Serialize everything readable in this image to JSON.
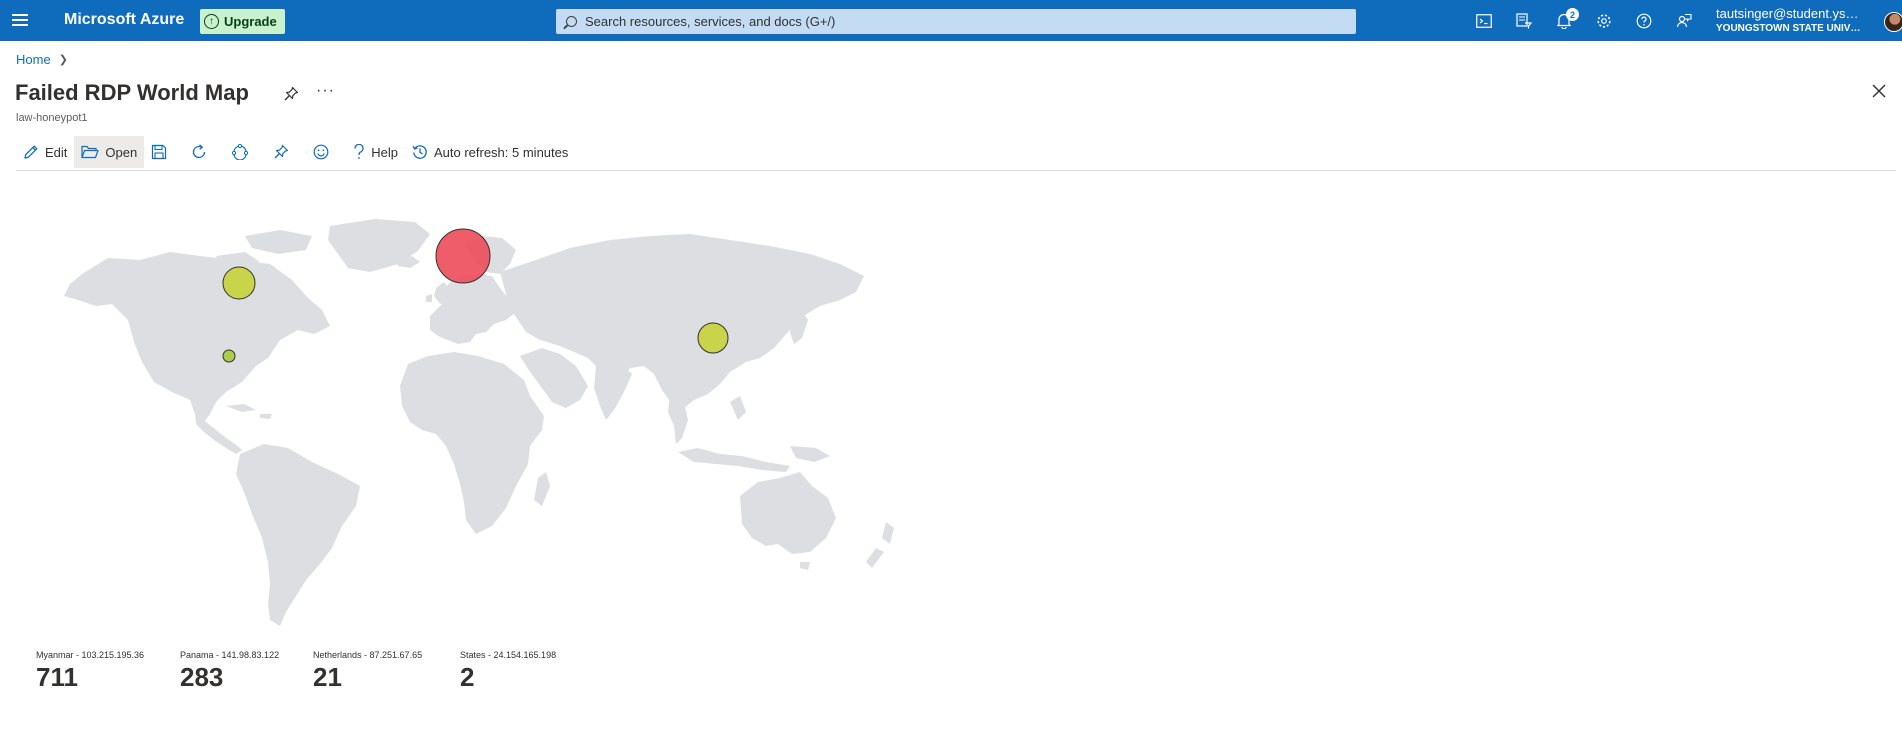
{
  "topbar": {
    "brand": "Microsoft Azure",
    "upgrade_label": "Upgrade",
    "search_placeholder": "Search resources, services, and docs (G+/)",
    "notification_count": "2",
    "user_email": "tautsinger@student.ysu....",
    "user_org": "YOUNGSTOWN STATE UNIVERSI...",
    "icons": [
      "cloud-shell-icon",
      "directory-filter-icon",
      "notifications-icon",
      "settings-icon",
      "help-icon",
      "feedback-icon"
    ]
  },
  "breadcrumb": {
    "home_label": "Home"
  },
  "page": {
    "title": "Failed RDP World Map",
    "subtitle": "law-honeypot1",
    "more_label": "···"
  },
  "toolbar": {
    "edit_label": "Edit",
    "open_label": "Open",
    "help_label": "Help",
    "autorefresh_label": "Auto refresh: 5 minutes"
  },
  "colors": {
    "azure_blue": "#0f6cbd",
    "land": "#dcdee2",
    "bubble_high": "#ee4b5a",
    "bubble_low": "#c5d33a",
    "upgrade_bg": "#c7f2cd"
  },
  "map_markers": [
    {
      "location": "Netherlands",
      "level": "high"
    },
    {
      "location": "States",
      "level": "medium"
    },
    {
      "location": "Myanmar",
      "level": "medium"
    },
    {
      "location": "Panama",
      "level": "low"
    }
  ],
  "tiles": [
    {
      "label": "Myanmar - 103.215.195.36",
      "value": "711"
    },
    {
      "label": "Panama - 141.98.83.122",
      "value": "283"
    },
    {
      "label": "Netherlands - 87.251.67.65",
      "value": "21"
    },
    {
      "label": "States - 24.154.165.198",
      "value": "2"
    }
  ]
}
